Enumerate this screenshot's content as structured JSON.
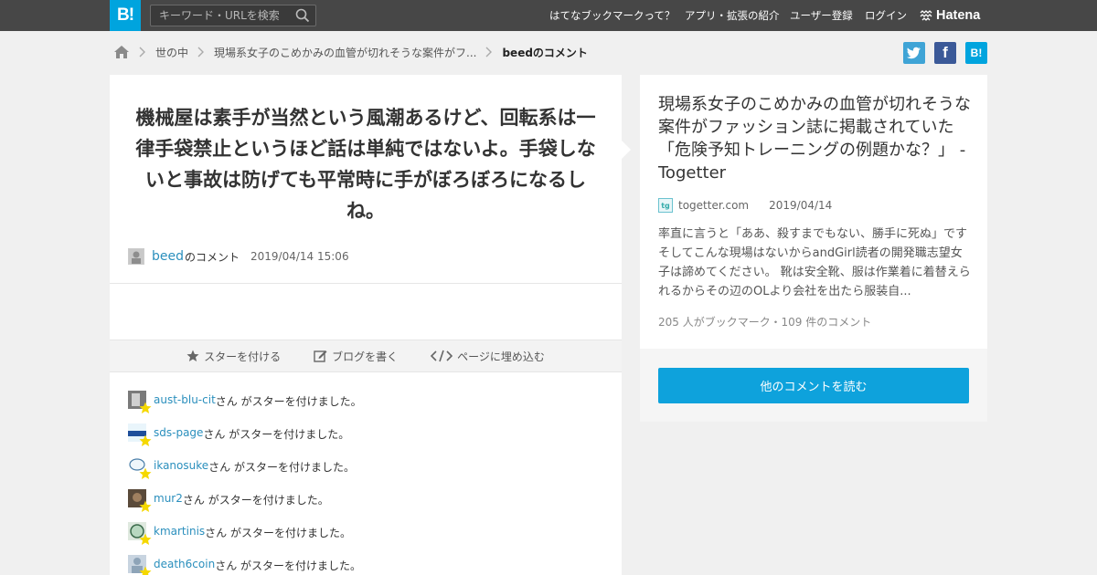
{
  "header": {
    "logo_text": "B!",
    "search_placeholder": "キーワード・URLを検索",
    "nav": [
      "はてなブックマークって？",
      "アプリ・拡張の紹介",
      "ユーザー登録",
      "ログイン"
    ],
    "brand": "Hatena"
  },
  "breadcrumb": {
    "items": [
      "世の中",
      "現場系女子のこめかみの血管が切れそうな案件がフ..."
    ],
    "current": "beedのコメント"
  },
  "share": {
    "twitter": "t",
    "facebook": "f",
    "hatena": "B!"
  },
  "comment": {
    "text": "機械屋は素手が当然という風潮あるけど、回転系は一律手袋禁止というほど話は単純ではないよ。手袋しないと事故は防げても平常時に手がぼろぼろになるしね。",
    "user": "beed",
    "user_suffix": "のコメント",
    "date": "2019/04/14 15:06"
  },
  "actions": {
    "star": "スターを付ける",
    "blog": "ブログを書く",
    "embed": "ページに埋め込む"
  },
  "stars": {
    "suffix": "さん がスターを付けました。",
    "users": [
      "aust-blu-cit",
      "sds-page",
      "ikanosuke",
      "mur2",
      "kmartinis",
      "death6coin"
    ]
  },
  "entry": {
    "title": "現場系女子のこめかみの血管が切れそうな案件がファッション誌に掲載されていた「危険予知トレーニングの例題かな？」 - Togetter",
    "site": "togetter.com",
    "date": "2019/04/14",
    "description": "率直に言うと「ああ、殺すまでもない、勝手に死ぬ」ですそしてこんな現場はないからandGirl読者の開発職志望女子は諦めてください。 靴は安全靴、服は作業着に着替えられるからその辺のOLより会社を出たら服装自...",
    "counts": "205 人がブックマーク・109 件のコメント",
    "button": "他のコメントを読む"
  },
  "colors": {
    "brand": "#00a4de",
    "topbar": "#474747",
    "link": "#2a8fbd",
    "button": "#0ea2dc"
  }
}
